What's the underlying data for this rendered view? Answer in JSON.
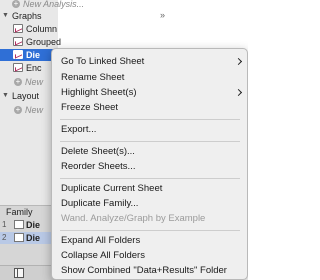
{
  "navigator": {
    "tree": {
      "new_analysis": "New Analysis...",
      "graphs_section": "Graphs",
      "graph_items": [
        "Column",
        "Grouped",
        "Die",
        "Enc"
      ],
      "new_graph": "New",
      "layouts_section": "Layout",
      "new_layout": "New"
    },
    "collapse_glyph": "»",
    "family": {
      "label": "Family",
      "items": [
        {
          "num": "1",
          "label": "Die"
        },
        {
          "num": "2",
          "label": "Die"
        }
      ]
    }
  },
  "menu": {
    "go_to_linked_sheet": "Go To Linked Sheet",
    "rename_sheet": "Rename Sheet",
    "highlight_sheets": "Highlight Sheet(s)",
    "freeze_sheet": "Freeze Sheet",
    "export": "Export...",
    "delete_sheets": "Delete Sheet(s)...",
    "reorder_sheets": "Reorder Sheets...",
    "duplicate_current_sheet": "Duplicate Current Sheet",
    "duplicate_family": "Duplicate Family...",
    "wand_analyze": "Wand. Analyze/Graph by Example",
    "expand_all_folders": "Expand All Folders",
    "collapse_all_folders": "Collapse All Folders",
    "show_combined_folder": "Show Combined \"Data+Results\" Folder"
  }
}
